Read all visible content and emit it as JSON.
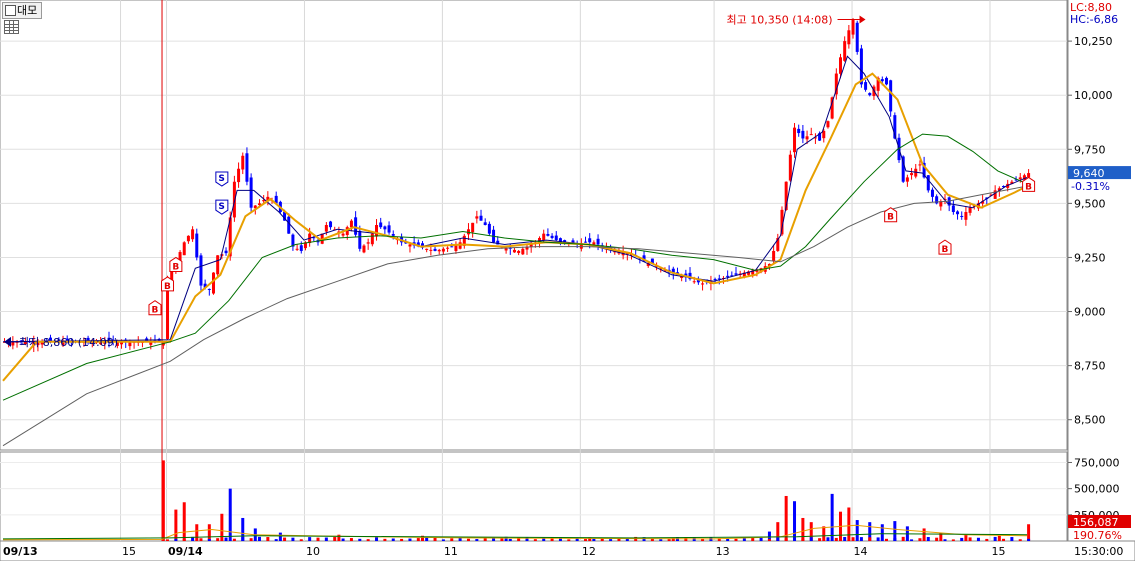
{
  "toolbar": {
    "label": "대모"
  },
  "chart_data": {
    "type": "candlestick",
    "price_axis": {
      "ticks": [
        "10,250",
        "10,000",
        "9,750",
        "9,500",
        "9,250",
        "9,000",
        "8,750",
        "8,500"
      ],
      "ylim": [
        8360,
        10440
      ],
      "lc": "LC:8,80",
      "hc": "HC:-6,86",
      "current_price": "9,640",
      "current_change": "-0.31%"
    },
    "volume_axis": {
      "ticks": [
        "750,000",
        "500,000",
        "250,000"
      ],
      "current_volume": "156,087",
      "current_ratio": "190.76%"
    },
    "time_axis": {
      "labels": [
        "09/13",
        "15",
        "09/14",
        "10",
        "11",
        "12",
        "13",
        "14",
        "15"
      ],
      "clock": "15:30:00"
    },
    "annotations": {
      "high": "최고 10,350 (14:08)",
      "low": "최저 8,860 (14:09)",
      "signals": [
        "B",
        "B",
        "B",
        "S",
        "S",
        "B",
        "B",
        "B"
      ]
    },
    "price_path": [
      [
        0,
        8860
      ],
      [
        38,
        8860
      ],
      [
        39,
        9140
      ],
      [
        41,
        9230
      ],
      [
        43,
        9320
      ],
      [
        45,
        9380
      ],
      [
        47,
        9120
      ],
      [
        49,
        9100
      ],
      [
        51,
        9260
      ],
      [
        53,
        9270
      ],
      [
        55,
        9600
      ],
      [
        57,
        9720
      ],
      [
        59,
        9480
      ],
      [
        61,
        9500
      ],
      [
        63,
        9530
      ],
      [
        65,
        9500
      ],
      [
        67,
        9420
      ],
      [
        69,
        9300
      ],
      [
        71,
        9280
      ],
      [
        73,
        9360
      ],
      [
        75,
        9320
      ],
      [
        77,
        9400
      ],
      [
        79,
        9380
      ],
      [
        81,
        9360
      ],
      [
        83,
        9420
      ],
      [
        85,
        9290
      ],
      [
        87,
        9320
      ],
      [
        89,
        9400
      ],
      [
        91,
        9380
      ],
      [
        93,
        9350
      ],
      [
        95,
        9320
      ],
      [
        97,
        9310
      ],
      [
        99,
        9300
      ],
      [
        101,
        9290
      ],
      [
        103,
        9280
      ],
      [
        105,
        9290
      ],
      [
        107,
        9300
      ],
      [
        109,
        9320
      ],
      [
        111,
        9380
      ],
      [
        113,
        9440
      ],
      [
        115,
        9400
      ],
      [
        117,
        9320
      ],
      [
        119,
        9300
      ],
      [
        121,
        9290
      ],
      [
        123,
        9280
      ],
      [
        125,
        9300
      ],
      [
        127,
        9320
      ],
      [
        129,
        9360
      ],
      [
        131,
        9340
      ],
      [
        133,
        9320
      ],
      [
        135,
        9320
      ],
      [
        137,
        9310
      ],
      [
        139,
        9320
      ],
      [
        141,
        9320
      ],
      [
        143,
        9300
      ],
      [
        145,
        9290
      ],
      [
        147,
        9280
      ],
      [
        149,
        9270
      ],
      [
        151,
        9260
      ],
      [
        153,
        9230
      ],
      [
        155,
        9220
      ],
      [
        157,
        9200
      ],
      [
        159,
        9180
      ],
      [
        161,
        9170
      ],
      [
        163,
        9160
      ],
      [
        165,
        9140
      ],
      [
        167,
        9130
      ],
      [
        169,
        9140
      ],
      [
        171,
        9150
      ],
      [
        173,
        9160
      ],
      [
        175,
        9170
      ],
      [
        177,
        9180
      ],
      [
        179,
        9190
      ],
      [
        181,
        9200
      ],
      [
        183,
        9220
      ],
      [
        185,
        9340
      ],
      [
        187,
        9600
      ],
      [
        189,
        9850
      ],
      [
        191,
        9800
      ],
      [
        193,
        9820
      ],
      [
        195,
        9790
      ],
      [
        197,
        9880
      ],
      [
        199,
        10100
      ],
      [
        201,
        10250
      ],
      [
        203,
        10350
      ],
      [
        205,
        10050
      ],
      [
        207,
        10000
      ],
      [
        209,
        10080
      ],
      [
        211,
        10050
      ],
      [
        213,
        9800
      ],
      [
        215,
        9600
      ],
      [
        217,
        9640
      ],
      [
        219,
        9680
      ],
      [
        221,
        9560
      ],
      [
        223,
        9500
      ],
      [
        225,
        9520
      ],
      [
        227,
        9460
      ],
      [
        229,
        9440
      ],
      [
        231,
        9480
      ],
      [
        233,
        9500
      ],
      [
        235,
        9520
      ],
      [
        237,
        9560
      ],
      [
        239,
        9580
      ],
      [
        241,
        9600
      ],
      [
        243,
        9620
      ],
      [
        245,
        9640
      ]
    ],
    "ma_series": [
      {
        "color": "#000080",
        "values": [
          [
            0,
            8860
          ],
          [
            40,
            8870
          ],
          [
            46,
            9200
          ],
          [
            52,
            9240
          ],
          [
            56,
            9560
          ],
          [
            60,
            9560
          ],
          [
            66,
            9460
          ],
          [
            72,
            9330
          ],
          [
            80,
            9380
          ],
          [
            90,
            9360
          ],
          [
            100,
            9300
          ],
          [
            110,
            9340
          ],
          [
            120,
            9310
          ],
          [
            130,
            9330
          ],
          [
            140,
            9310
          ],
          [
            150,
            9260
          ],
          [
            160,
            9170
          ],
          [
            170,
            9140
          ],
          [
            180,
            9190
          ],
          [
            186,
            9350
          ],
          [
            190,
            9750
          ],
          [
            196,
            9830
          ],
          [
            202,
            10180
          ],
          [
            206,
            10100
          ],
          [
            212,
            9900
          ],
          [
            216,
            9650
          ],
          [
            220,
            9640
          ],
          [
            226,
            9500
          ],
          [
            232,
            9480
          ],
          [
            240,
            9580
          ],
          [
            245,
            9620
          ]
        ]
      },
      {
        "color": "#e8a000",
        "values": [
          [
            0,
            8680
          ],
          [
            8,
            8860
          ],
          [
            40,
            8860
          ],
          [
            46,
            9070
          ],
          [
            52,
            9170
          ],
          [
            58,
            9440
          ],
          [
            64,
            9520
          ],
          [
            70,
            9420
          ],
          [
            76,
            9330
          ],
          [
            84,
            9390
          ],
          [
            92,
            9350
          ],
          [
            100,
            9300
          ],
          [
            110,
            9310
          ],
          [
            120,
            9300
          ],
          [
            130,
            9320
          ],
          [
            140,
            9310
          ],
          [
            150,
            9270
          ],
          [
            160,
            9180
          ],
          [
            170,
            9130
          ],
          [
            180,
            9170
          ],
          [
            186,
            9240
          ],
          [
            192,
            9560
          ],
          [
            198,
            9800
          ],
          [
            204,
            10050
          ],
          [
            208,
            10100
          ],
          [
            214,
            9980
          ],
          [
            220,
            9680
          ],
          [
            226,
            9540
          ],
          [
            234,
            9480
          ],
          [
            242,
            9550
          ],
          [
            245,
            9580
          ]
        ]
      },
      {
        "color": "#007000",
        "values": [
          [
            0,
            8590
          ],
          [
            20,
            8760
          ],
          [
            40,
            8860
          ],
          [
            46,
            8900
          ],
          [
            54,
            9050
          ],
          [
            62,
            9250
          ],
          [
            70,
            9310
          ],
          [
            80,
            9340
          ],
          [
            90,
            9350
          ],
          [
            100,
            9340
          ],
          [
            110,
            9370
          ],
          [
            120,
            9340
          ],
          [
            130,
            9320
          ],
          [
            140,
            9310
          ],
          [
            150,
            9290
          ],
          [
            160,
            9260
          ],
          [
            170,
            9240
          ],
          [
            180,
            9190
          ],
          [
            186,
            9210
          ],
          [
            192,
            9300
          ],
          [
            198,
            9430
          ],
          [
            206,
            9600
          ],
          [
            214,
            9750
          ],
          [
            220,
            9820
          ],
          [
            226,
            9810
          ],
          [
            232,
            9740
          ],
          [
            238,
            9650
          ],
          [
            245,
            9590
          ]
        ]
      },
      {
        "color": "#606060",
        "values": [
          [
            0,
            8380
          ],
          [
            20,
            8620
          ],
          [
            40,
            8770
          ],
          [
            48,
            8870
          ],
          [
            58,
            8970
          ],
          [
            68,
            9060
          ],
          [
            80,
            9140
          ],
          [
            92,
            9220
          ],
          [
            104,
            9260
          ],
          [
            116,
            9290
          ],
          [
            128,
            9300
          ],
          [
            140,
            9300
          ],
          [
            152,
            9290
          ],
          [
            164,
            9270
          ],
          [
            176,
            9250
          ],
          [
            186,
            9230
          ],
          [
            194,
            9300
          ],
          [
            202,
            9390
          ],
          [
            210,
            9460
          ],
          [
            218,
            9500
          ],
          [
            226,
            9510
          ],
          [
            234,
            9540
          ],
          [
            245,
            9580
          ]
        ]
      }
    ],
    "volume_bars": [
      [
        38,
        770000
      ],
      [
        41,
        300000
      ],
      [
        43,
        370000
      ],
      [
        46,
        160000
      ],
      [
        49,
        160000
      ],
      [
        52,
        260000
      ],
      [
        54,
        500000
      ],
      [
        57,
        220000
      ],
      [
        60,
        120000
      ],
      [
        66,
        80000
      ],
      [
        80,
        60000
      ],
      [
        100,
        50000
      ],
      [
        120,
        40000
      ],
      [
        140,
        35000
      ],
      [
        160,
        30000
      ],
      [
        183,
        90000
      ],
      [
        185,
        180000
      ],
      [
        187,
        430000
      ],
      [
        189,
        380000
      ],
      [
        191,
        220000
      ],
      [
        193,
        180000
      ],
      [
        196,
        140000
      ],
      [
        198,
        450000
      ],
      [
        200,
        280000
      ],
      [
        202,
        320000
      ],
      [
        204,
        200000
      ],
      [
        207,
        180000
      ],
      [
        210,
        160000
      ],
      [
        213,
        190000
      ],
      [
        216,
        140000
      ],
      [
        220,
        120000
      ],
      [
        224,
        80000
      ],
      [
        230,
        60000
      ],
      [
        238,
        50000
      ],
      [
        245,
        160000
      ]
    ]
  }
}
